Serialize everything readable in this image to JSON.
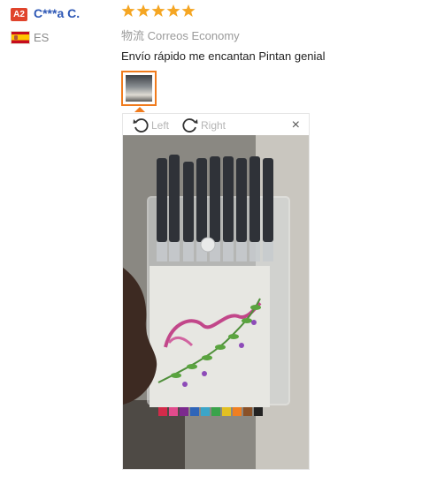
{
  "reviewer": {
    "badge": "A2",
    "name": "C***a C.",
    "country": "ES"
  },
  "review": {
    "rating": 5,
    "logistics_label": "物流",
    "logistics_value": "Correos Economy",
    "text": "Envío rápido me encantan Pintan genial"
  },
  "viewer": {
    "rotate_left": "Left",
    "rotate_right": "Right",
    "close": "×"
  },
  "colors": {
    "star": "#f5a623",
    "badge": "#e0442c",
    "name": "#2d57b5",
    "thumb_border": "#f07b1d"
  },
  "icons": [
    "rotate-left-icon",
    "rotate-right-icon",
    "close-icon",
    "star-icon",
    "spain-flag-icon"
  ]
}
